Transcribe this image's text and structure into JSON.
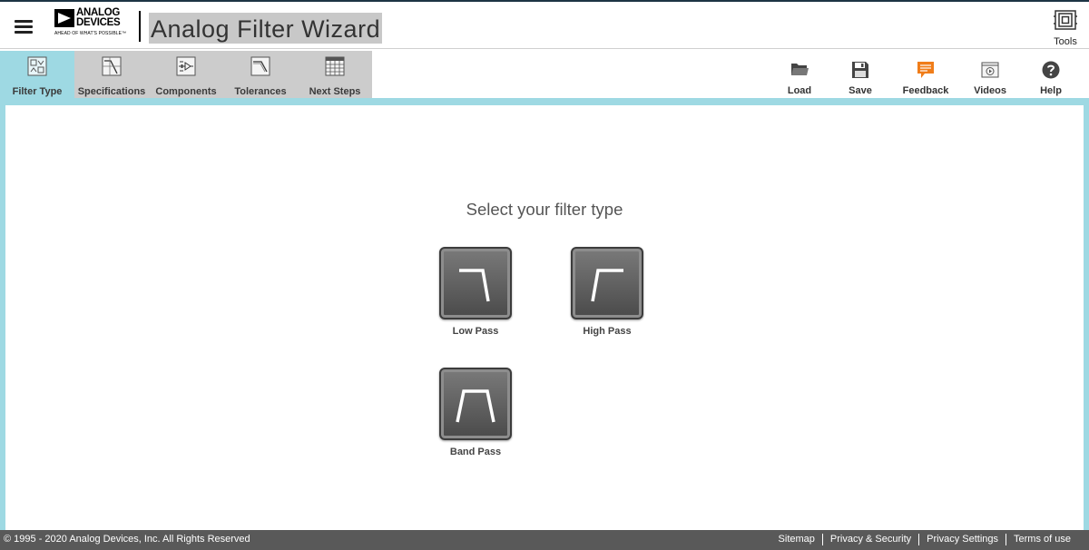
{
  "header": {
    "logo_line1": "ANALOG",
    "logo_line2": "DEVICES",
    "logo_tagline": "AHEAD OF WHAT'S POSSIBLE™",
    "app_title": "Analog Filter Wizard",
    "tools_label": "Tools"
  },
  "steps": [
    {
      "label": "Filter Type",
      "icon": "filter-type-icon",
      "active": true
    },
    {
      "label": "Specifications",
      "icon": "specifications-icon",
      "active": false
    },
    {
      "label": "Components",
      "icon": "components-icon",
      "active": false
    },
    {
      "label": "Tolerances",
      "icon": "tolerances-icon",
      "active": false
    },
    {
      "label": "Next Steps",
      "icon": "next-steps-icon",
      "active": false
    }
  ],
  "actions": [
    {
      "label": "Load",
      "icon": "folder-icon"
    },
    {
      "label": "Save",
      "icon": "floppy-disk-icon"
    },
    {
      "label": "Feedback",
      "icon": "speech-bubble-icon"
    },
    {
      "label": "Videos",
      "icon": "video-icon"
    },
    {
      "label": "Help",
      "icon": "question-mark-icon"
    }
  ],
  "main": {
    "prompt": "Select your filter type",
    "filters": [
      {
        "label": "Low Pass",
        "icon": "low-pass-icon"
      },
      {
        "label": "High Pass",
        "icon": "high-pass-icon"
      },
      {
        "label": "Band Pass",
        "icon": "band-pass-icon"
      }
    ]
  },
  "footer": {
    "copyright": "© 1995 - 2020 Analog Devices, Inc. All Rights Reserved",
    "links": [
      "Sitemap",
      "Privacy & Security",
      "Privacy Settings",
      "Terms of use"
    ]
  },
  "colors": {
    "accent": "#9ed9e3",
    "inactive_step": "#cccccc",
    "feedback_orange": "#f07d1a",
    "footer_bg": "#595959"
  }
}
